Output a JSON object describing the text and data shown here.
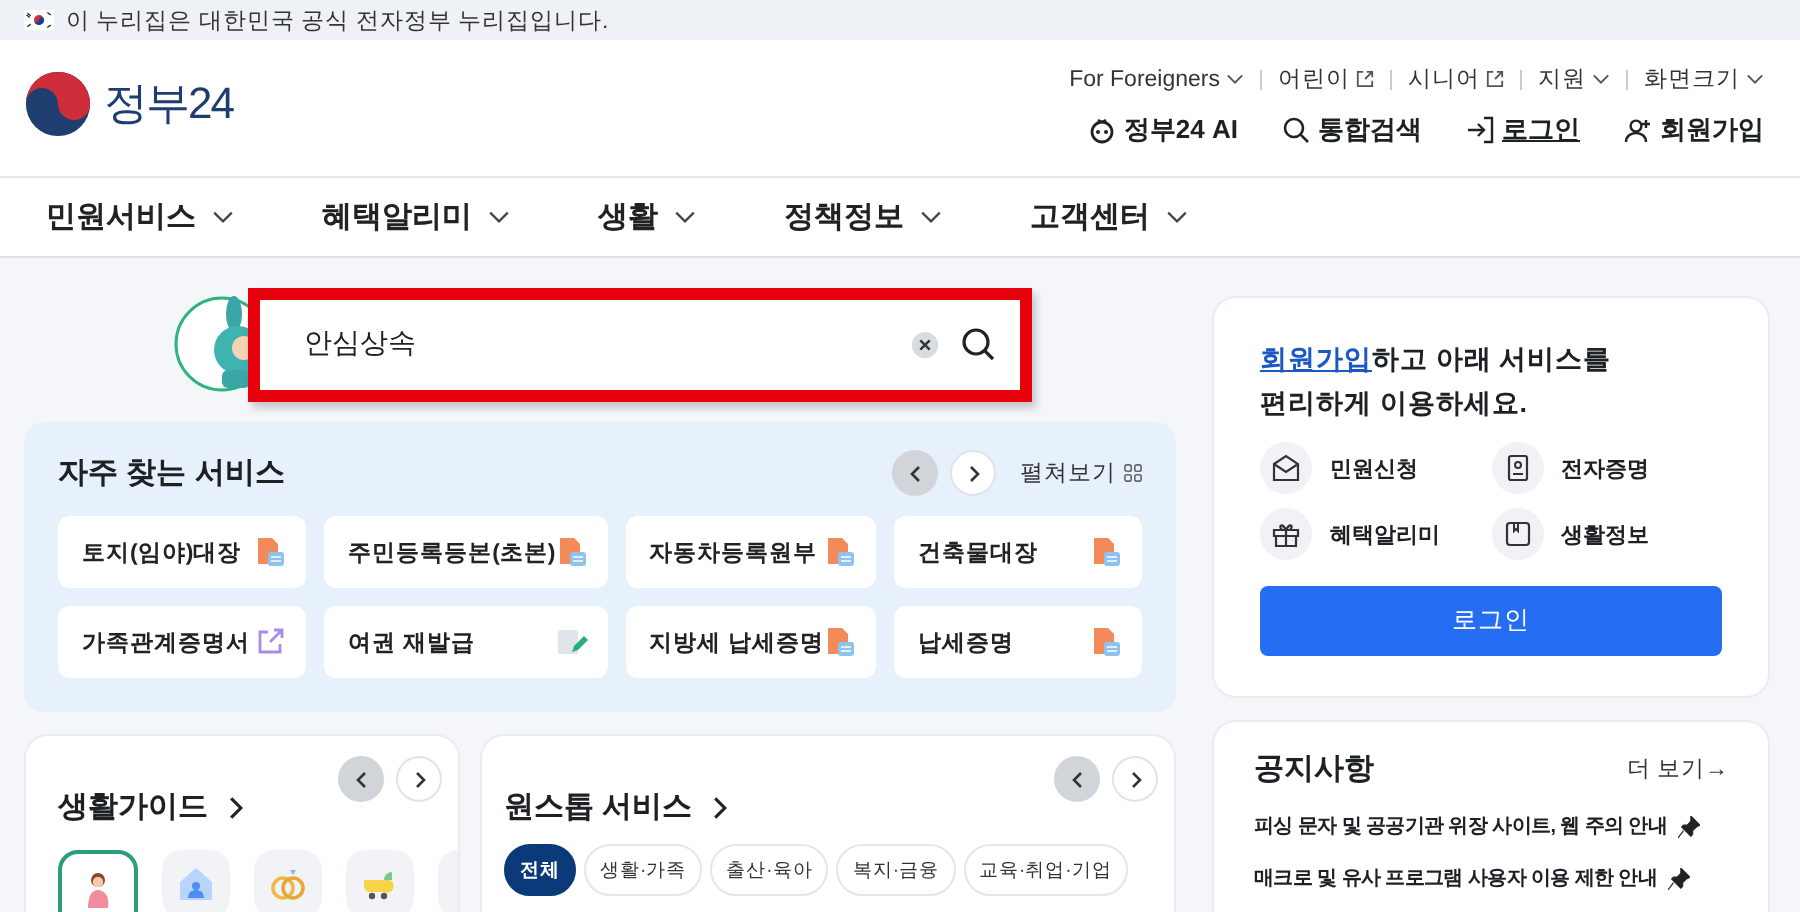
{
  "banner": {
    "text": "이 누리집은 대한민국 공식 전자정부 누리집입니다."
  },
  "header": {
    "logo": "정부24",
    "util_links": [
      {
        "label": "For Foreigners",
        "kind": "dropdown"
      },
      {
        "label": "어린이",
        "kind": "external"
      },
      {
        "label": "시니어",
        "kind": "external"
      },
      {
        "label": "지원",
        "kind": "dropdown"
      },
      {
        "label": "화면크기",
        "kind": "dropdown"
      }
    ],
    "actions": [
      {
        "label": "정부24 AI",
        "kind": "ai"
      },
      {
        "label": "통합검색",
        "kind": "search"
      },
      {
        "label": "로그인",
        "kind": "login"
      },
      {
        "label": "회원가입",
        "kind": "signup"
      }
    ]
  },
  "nav": [
    {
      "label": "민원서비스"
    },
    {
      "label": "혜택알리미"
    },
    {
      "label": "생활"
    },
    {
      "label": "정책정보"
    },
    {
      "label": "고객센터"
    }
  ],
  "search": {
    "value": "안심상속"
  },
  "frequent": {
    "title": "자주 찾는 서비스",
    "expand_label": "펼쳐보기",
    "prev_disabled": true,
    "items": [
      {
        "label": "토지(임야)대장",
        "kind": "pdf"
      },
      {
        "label": "주민등록등본(초본)",
        "kind": "pdf"
      },
      {
        "label": "자동차등록원부",
        "kind": "pdf"
      },
      {
        "label": "건축물대장",
        "kind": "pdf"
      },
      {
        "label": "가족관계증명서",
        "kind": "external"
      },
      {
        "label": "여권 재발급",
        "kind": "edit"
      },
      {
        "label": "지방세 납세증명",
        "kind": "pdf"
      },
      {
        "label": "납세증명",
        "kind": "pdf"
      }
    ]
  },
  "login_card": {
    "link": "회원가입",
    "text": "하고 아래 서비스를 편리하게 이용하세요.",
    "services": [
      {
        "label": "민원신청",
        "kind": "mail"
      },
      {
        "label": "전자증명",
        "kind": "id"
      },
      {
        "label": "혜택알리미",
        "kind": "gift"
      },
      {
        "label": "생활정보",
        "kind": "book"
      }
    ],
    "button": "로그인"
  },
  "life_guide": {
    "title": "생활가이드",
    "prev_disabled": true,
    "icons": [
      {
        "kind": "pregnant",
        "selected": true
      },
      {
        "kind": "house",
        "selected": false
      },
      {
        "kind": "rings",
        "selected": false
      },
      {
        "kind": "stroller",
        "selected": false
      },
      {
        "kind": "blank",
        "selected": false
      }
    ]
  },
  "onestop": {
    "title": "원스톱 서비스",
    "prev_disabled": true,
    "chips": [
      {
        "label": "전체",
        "selected": true
      },
      {
        "label": "생활·가족",
        "selected": false
      },
      {
        "label": "출산·육아",
        "selected": false
      },
      {
        "label": "복지·금융",
        "selected": false
      },
      {
        "label": "교육·취업·기업",
        "selected": false
      }
    ]
  },
  "notice": {
    "title": "공지사항",
    "more": "더 보기→",
    "items": [
      {
        "label": "피싱 문자 및 공공기관 위장 사이트, 웹 주의 안내",
        "pinned": true
      },
      {
        "label": "매크로 및 유사 프로그램 사용자 이용 제한 안내",
        "pinned": true
      }
    ]
  }
}
